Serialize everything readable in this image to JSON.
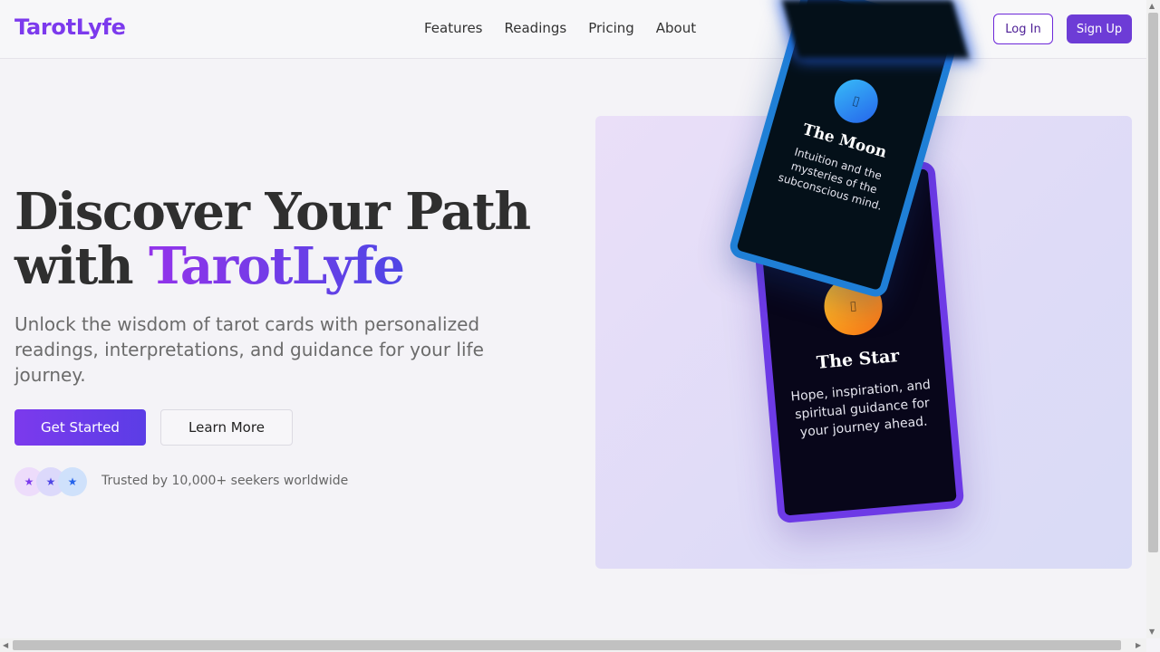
{
  "header": {
    "logo": "TarotLyfe",
    "nav": [
      "Features",
      "Readings",
      "Pricing",
      "About"
    ],
    "login_label": "Log In",
    "signup_label": "Sign Up"
  },
  "hero": {
    "title_line1": "Discover Your Path",
    "title_with": "with ",
    "title_accent": "TarotLyfe",
    "subtitle": "Unlock the wisdom of tarot cards with personalized readings, interpretations, and guidance for your life journey.",
    "get_started_label": "Get Started",
    "learn_more_label": "Learn More",
    "trusted_text": "Trusted by 10,000+ seekers worldwide"
  },
  "cards": {
    "star": {
      "title": "The Star",
      "description": "Hope, inspiration, and spiritual guidance for your journey ahead.",
      "orb_icon": "card-icon"
    },
    "moon": {
      "title": "The Moon",
      "description": "Intuition and the mysteries of the subconscious mind.",
      "orb_icon": "card-icon"
    }
  },
  "colors": {
    "brand": "#7c3aed",
    "accent_gradient_end": "#4f46e5",
    "moon_border": "#1f7fd6",
    "star_border": "#6d3ae6"
  }
}
